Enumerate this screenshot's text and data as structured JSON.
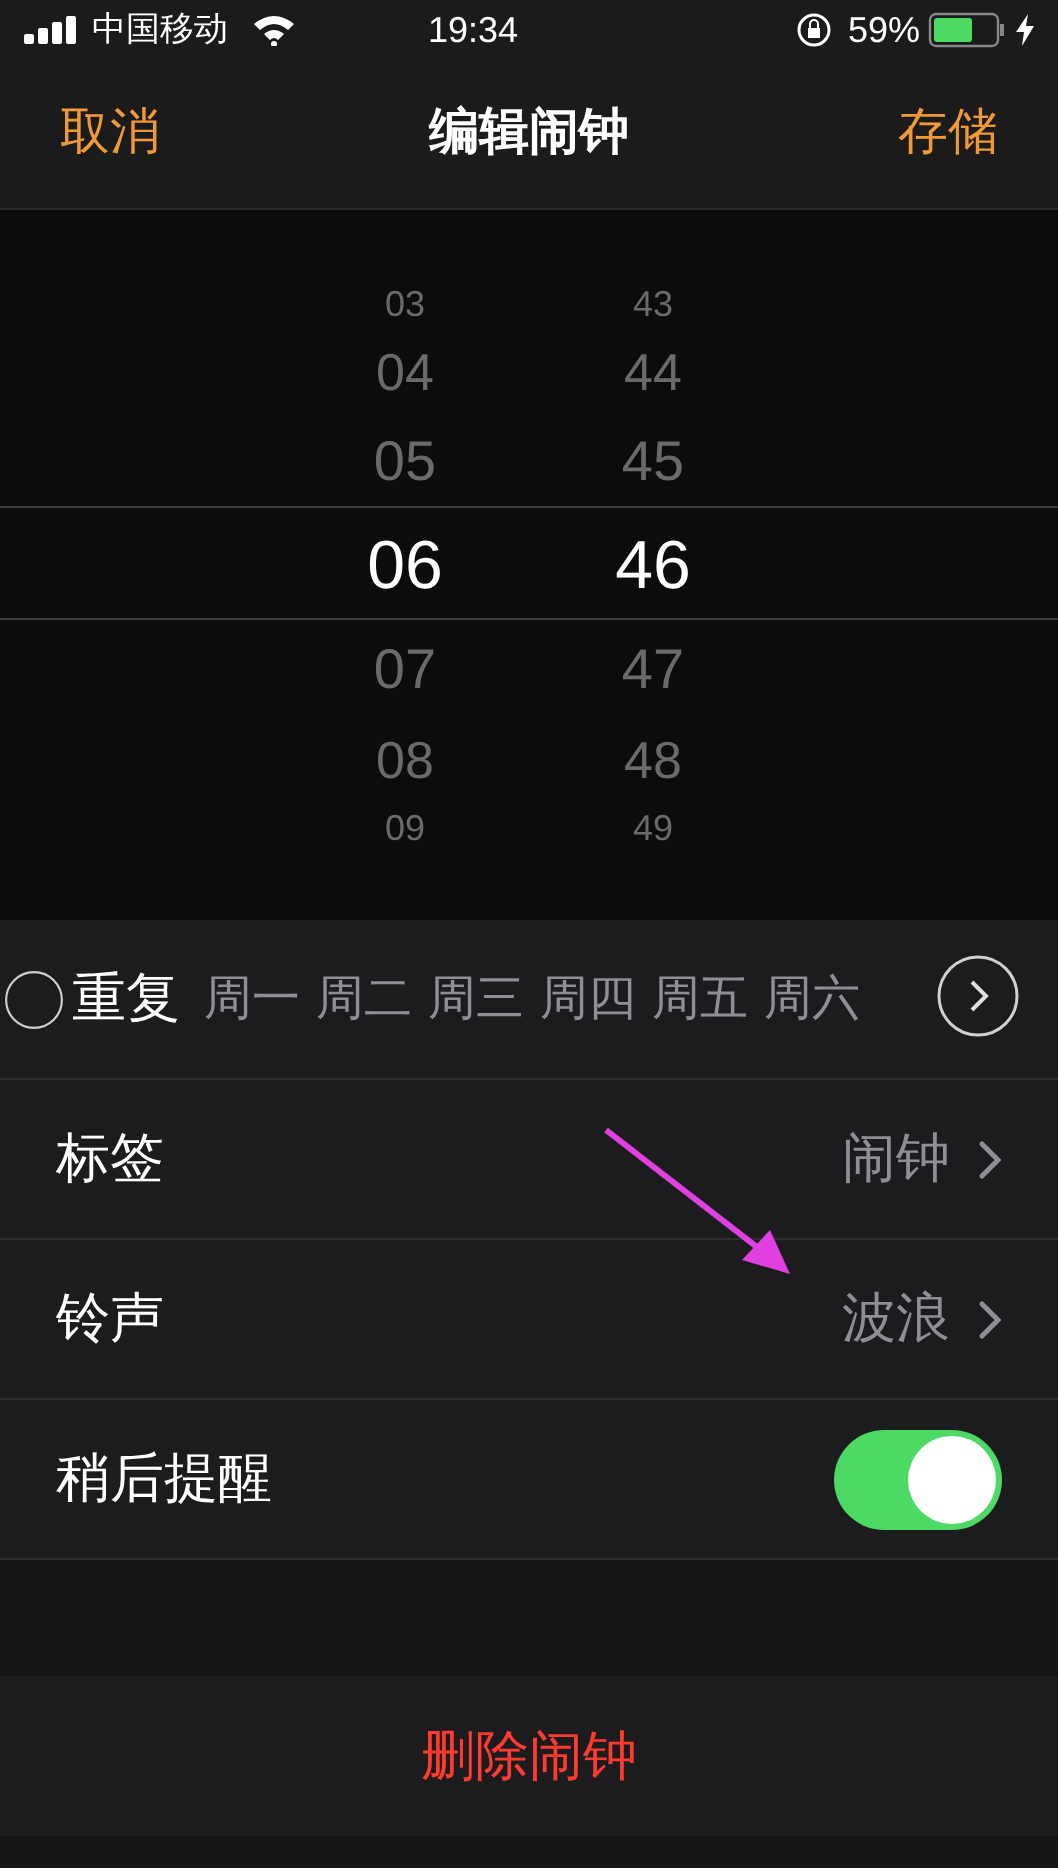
{
  "status_bar": {
    "carrier": "中国移动",
    "time": "19:34",
    "battery": "59%"
  },
  "nav": {
    "cancel": "取消",
    "title": "编辑闹钟",
    "save": "存储"
  },
  "picker": {
    "hours": [
      {
        "text": "03",
        "selected": false
      },
      {
        "text": "04",
        "selected": false
      },
      {
        "text": "05",
        "selected": false
      },
      {
        "text": "06",
        "selected": true
      },
      {
        "text": "07",
        "selected": false
      },
      {
        "text": "08",
        "selected": false
      },
      {
        "text": "09",
        "selected": false
      }
    ],
    "minutes": [
      {
        "text": "43",
        "selected": false
      },
      {
        "text": "44",
        "selected": false
      },
      {
        "text": "45",
        "selected": false
      },
      {
        "text": "46",
        "selected": true
      },
      {
        "text": "47",
        "selected": false
      },
      {
        "text": "48",
        "selected": false
      },
      {
        "text": "49",
        "selected": false
      }
    ]
  },
  "rows": [
    {
      "kind": "repeat",
      "label": "重复",
      "days": [
        "周一",
        "周二",
        "周三",
        "周四",
        "周五",
        "周六"
      ]
    },
    {
      "kind": "link",
      "label": "标签",
      "value": "闹钟"
    },
    {
      "kind": "link",
      "label": "铃声",
      "value": "波浪"
    },
    {
      "kind": "toggle",
      "label": "稍后提醒",
      "on": true
    }
  ],
  "delete_button": "删除闹钟"
}
